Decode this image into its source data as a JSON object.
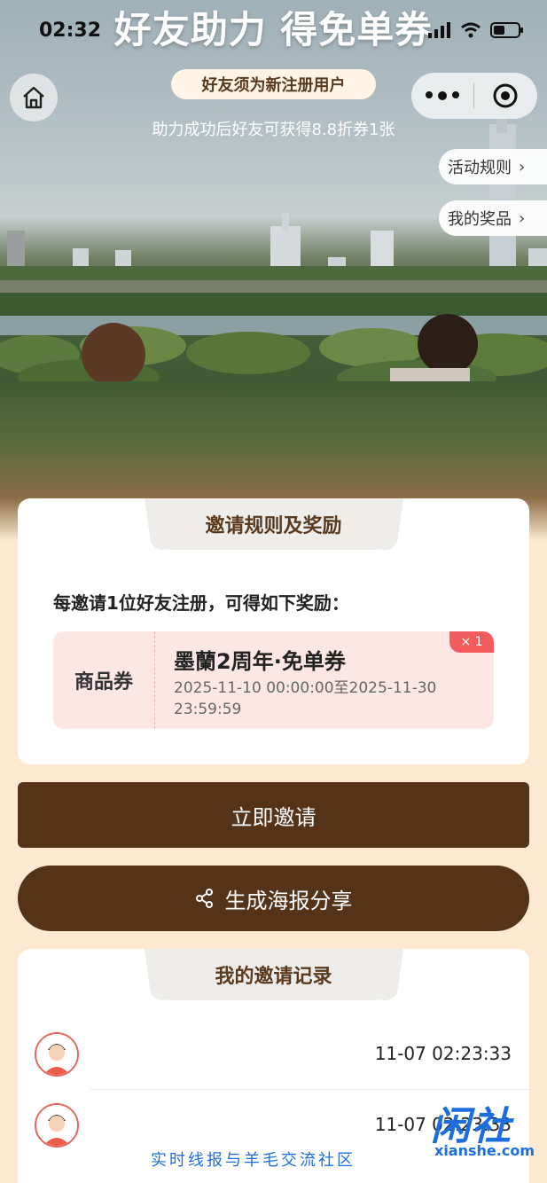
{
  "status_bar": {
    "time": "02:32"
  },
  "hero": {
    "title": "好友助力 得免单券",
    "notice": "好友须为新注册用户",
    "sub_note": "助力成功后好友可获得8.8折券1张"
  },
  "side_links": [
    {
      "label": "活动规则"
    },
    {
      "label": "我的奖品"
    }
  ],
  "rules_card": {
    "tab_title": "邀请规则及奖励",
    "intro": "每邀请1位好友注册，可得如下奖励：",
    "coupon": {
      "type": "商品券",
      "name": "墨蘭2周年·免单券",
      "validity": "2025-11-10 00:00:00至2025-11-30 23:59:59",
      "quantity": "× 1"
    }
  },
  "actions": {
    "invite_label": "立即邀请",
    "poster_label": "生成海报分享"
  },
  "records_card": {
    "tab_title": "我的邀请记录",
    "rows": [
      {
        "time": "11-07 02:23:33"
      },
      {
        "time": "11-07 02:23:33"
      }
    ]
  },
  "watermark": {
    "logo_cn": "闲社",
    "logo_en": "xianshe.com",
    "tagline": "实时线报与羊毛交流社区"
  },
  "colors": {
    "brand_brown": "#553319",
    "page_bg": "#fde9d2",
    "coupon_bg": "#fde7e4",
    "badge_red": "#f25c5c"
  }
}
